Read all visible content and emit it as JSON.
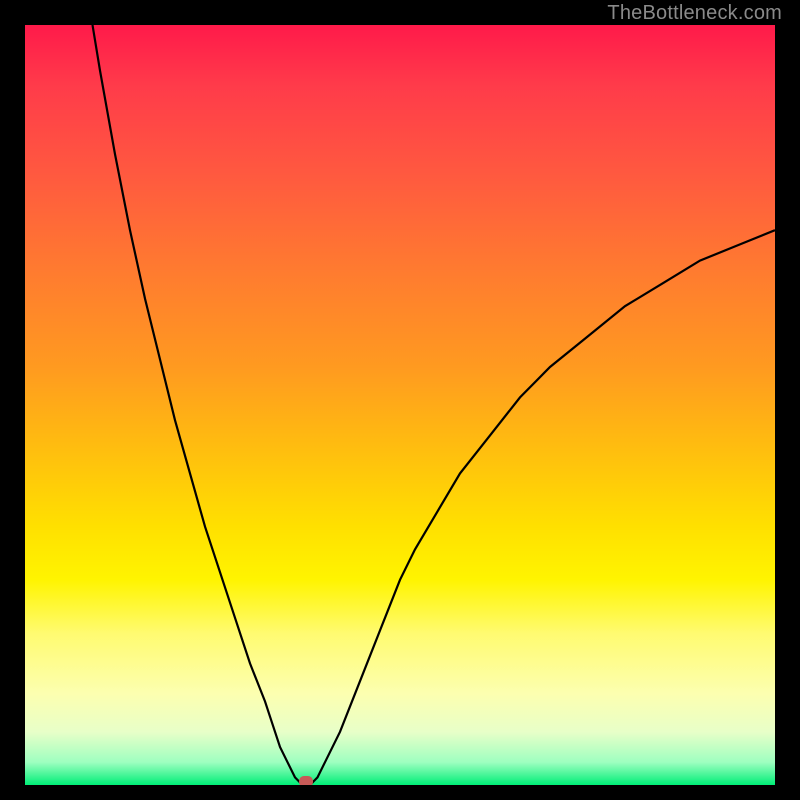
{
  "meta": {
    "watermark": "TheBottleneck.com"
  },
  "colors": {
    "curve": "#000000",
    "marker": "#c75a57",
    "frame": "#000000"
  },
  "chart_data": {
    "type": "line",
    "title": "",
    "xlabel": "",
    "ylabel": "",
    "xlim": [
      0,
      100
    ],
    "ylim": [
      0,
      100
    ],
    "grid": false,
    "legend": false,
    "description": "Bottleneck severity curve. The vertical axis is bottleneck percentage (top = 100% bottleneck, bottom = 0%). The horizontal axis is a hardware balance parameter. The curve dips to ~0% at the optimal balance point and rises steeply to either side; the left branch starts near 100% at x≈9 and the right branch rises to ~73% at x=100.",
    "x": [
      9,
      10,
      12,
      14,
      16,
      18,
      20,
      22,
      24,
      26,
      28,
      30,
      32,
      33,
      34,
      35,
      36,
      37,
      38,
      39,
      40,
      42,
      44,
      46,
      48,
      50,
      52,
      55,
      58,
      62,
      66,
      70,
      75,
      80,
      85,
      90,
      95,
      100
    ],
    "values": [
      100,
      94,
      83,
      73,
      64,
      56,
      48,
      41,
      34,
      28,
      22,
      16,
      11,
      8,
      5,
      3,
      1,
      0,
      0,
      1,
      3,
      7,
      12,
      17,
      22,
      27,
      31,
      36,
      41,
      46,
      51,
      55,
      59,
      63,
      66,
      69,
      71,
      73
    ],
    "optimal_x": 37.5,
    "optimal_y": 0,
    "marker": {
      "x": 37.5,
      "y": 0,
      "color": "#c75a57"
    }
  }
}
